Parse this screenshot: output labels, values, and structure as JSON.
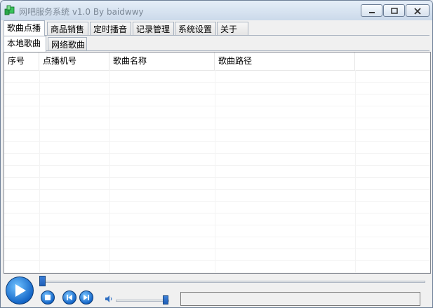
{
  "window": {
    "title": "网吧服务系统 v1.0 By baidwwy",
    "minimize_icon": "minimize-icon",
    "maximize_icon": "maximize-icon",
    "close_icon": "close-icon"
  },
  "tabs": {
    "main": [
      "歌曲点播",
      "商品销售",
      "定时播音",
      "记录管理",
      "系统设置",
      "关于"
    ],
    "sub": [
      "本地歌曲",
      "网络歌曲"
    ]
  },
  "table": {
    "columns": [
      "序号",
      "点播机号",
      "歌曲名称",
      "歌曲路径"
    ]
  },
  "player": {
    "progress": 0.0,
    "volume": 0.95
  },
  "colors": {
    "accent": "#1466c7",
    "border": "#828790"
  }
}
